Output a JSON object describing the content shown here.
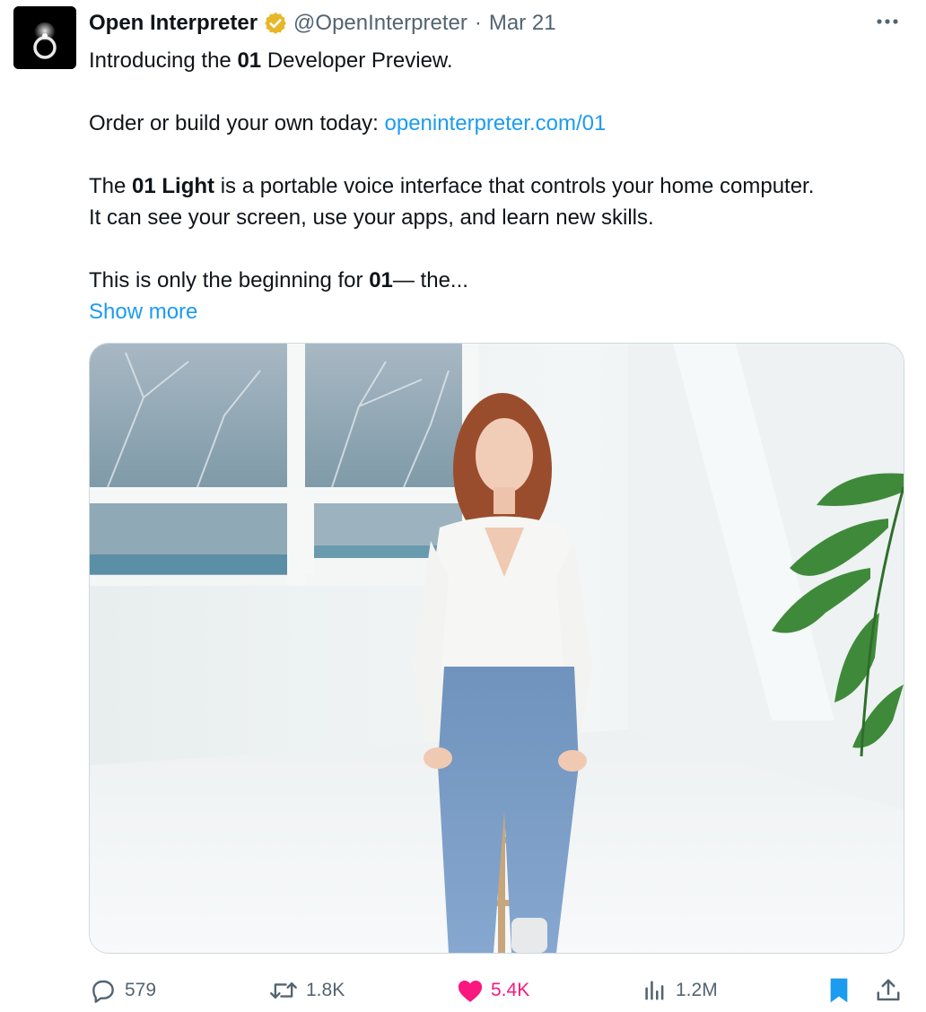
{
  "tweet": {
    "author_name": "Open Interpreter",
    "handle": "@OpenInterpreter",
    "separator": "·",
    "date": "Mar 21",
    "lines": {
      "intro_pre": "Introducing the ",
      "intro_bold": "01",
      "intro_post": " Developer Preview.",
      "order_pre": "Order or build your own today: ",
      "order_link": "openinterpreter.com/01",
      "light_pre": "The ",
      "light_bold": "01 Light",
      "light_post": " is a portable voice interface that controls your home computer.",
      "light_line2": "It can see your screen, use your apps, and learn new skills.",
      "begin_pre": "This is only the beginning for ",
      "begin_bold": "01",
      "begin_post": "— the..."
    },
    "show_more": "Show more"
  },
  "actions": {
    "replies": "579",
    "reposts": "1.8K",
    "likes": "5.4K",
    "views": "1.2M"
  },
  "icons": {
    "avatar": "ring-logo-icon",
    "verified": "verified-badge-icon",
    "more": "more-dots-icon",
    "reply": "reply-bubble-icon",
    "repost": "repost-icon",
    "like": "heart-icon",
    "views": "views-bar-chart-icon",
    "bookmark": "bookmark-icon",
    "share": "share-upload-icon"
  },
  "colors": {
    "link": "#1d9bf0",
    "like": "#f91880",
    "verified": "#e8b729",
    "bookmark": "#1d9bf0",
    "muted": "#536471",
    "text": "#0f1419"
  }
}
